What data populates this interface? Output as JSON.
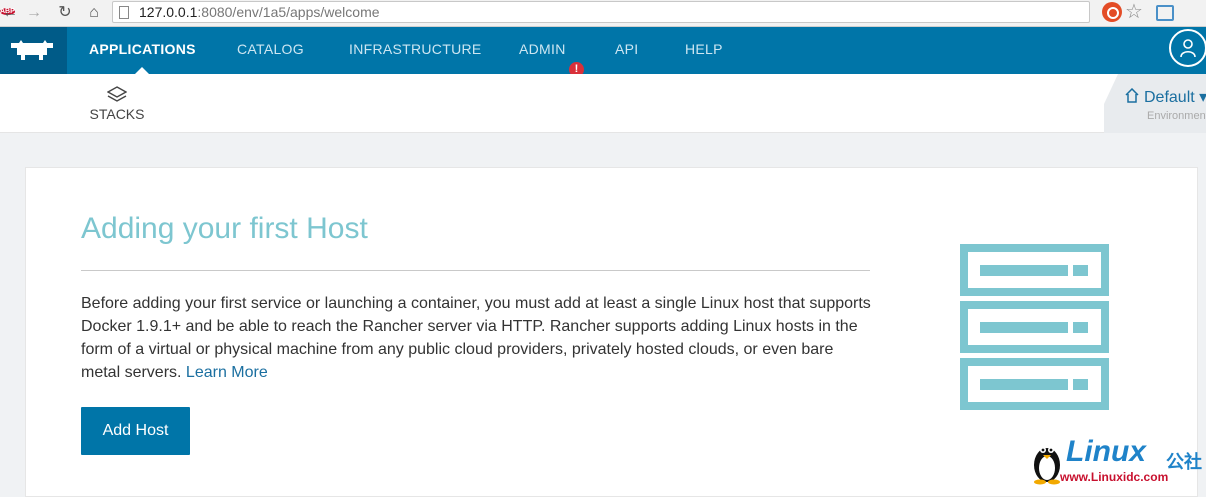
{
  "browser": {
    "url_host": "127.0.0.1",
    "url_rest": ":8080/env/1a5/apps/welcome",
    "abp_label": "ABP"
  },
  "topnav": {
    "items": [
      {
        "label": "APPLICATIONS",
        "active": true
      },
      {
        "label": "CATALOG",
        "active": false
      },
      {
        "label": "INFRASTRUCTURE",
        "active": false
      },
      {
        "label": "ADMIN",
        "active": false,
        "alert": "!"
      },
      {
        "label": "API",
        "active": false
      },
      {
        "label": "HELP",
        "active": false
      }
    ]
  },
  "subnav": {
    "stacks_label": "STACKS",
    "environment": {
      "name": "Default",
      "subtitle": "Environment"
    }
  },
  "welcome": {
    "title": "Adding your first Host",
    "body": "Before adding your first service or launching a container, you must add at least a single Linux host that supports Docker 1.9.1+ and be able to reach the Rancher server via HTTP. Rancher supports adding Linux hosts in the form of a virtual or physical machine from any public cloud providers, privately hosted clouds, or even bare metal servers.",
    "learn_more": "Learn More",
    "add_host": "Add Host"
  },
  "watermark": {
    "brand": "Linux",
    "brand_cn": "公社",
    "url": "www.Linuxidc.com"
  },
  "colors": {
    "nav_bg": "#0075a8",
    "logo_bg": "#005b88",
    "title": "#7dc6d0",
    "link": "#1b6fa0",
    "alert": "#d9303a"
  }
}
